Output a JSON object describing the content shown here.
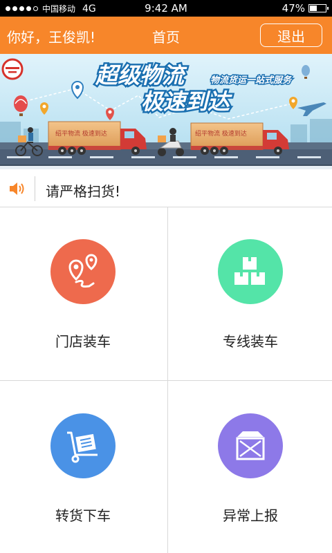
{
  "status_bar": {
    "carrier": "中国移动",
    "network": "4G",
    "time": "9:42 AM",
    "battery": "47%",
    "battery_level": 0.47,
    "signal_dots_filled": 4,
    "signal_dots_total": 5
  },
  "header": {
    "greeting": "你好，王俊凯!",
    "title": "首页",
    "logout_label": "退出",
    "background_color": "#f7862a"
  },
  "banner": {
    "headline_line1": "超级物流",
    "headline_line2": "极速到达",
    "tagline": "物流货运一站式服务",
    "truck1_text": "绍平物流 极速到达",
    "truck2_text": "绍平物流 极速到达"
  },
  "notice": {
    "icon": "speaker-icon",
    "text": "请严格扫货!"
  },
  "menu": {
    "items": [
      {
        "label": "门店装车",
        "icon": "map-route-icon",
        "color": "#ee6a4d"
      },
      {
        "label": "专线装车",
        "icon": "boxes-icon",
        "color": "#54e4a8"
      },
      {
        "label": "转货下车",
        "icon": "hand-truck-icon",
        "color": "#4a92e6"
      },
      {
        "label": "异常上报",
        "icon": "damaged-box-icon",
        "color": "#8d79e8"
      }
    ]
  }
}
